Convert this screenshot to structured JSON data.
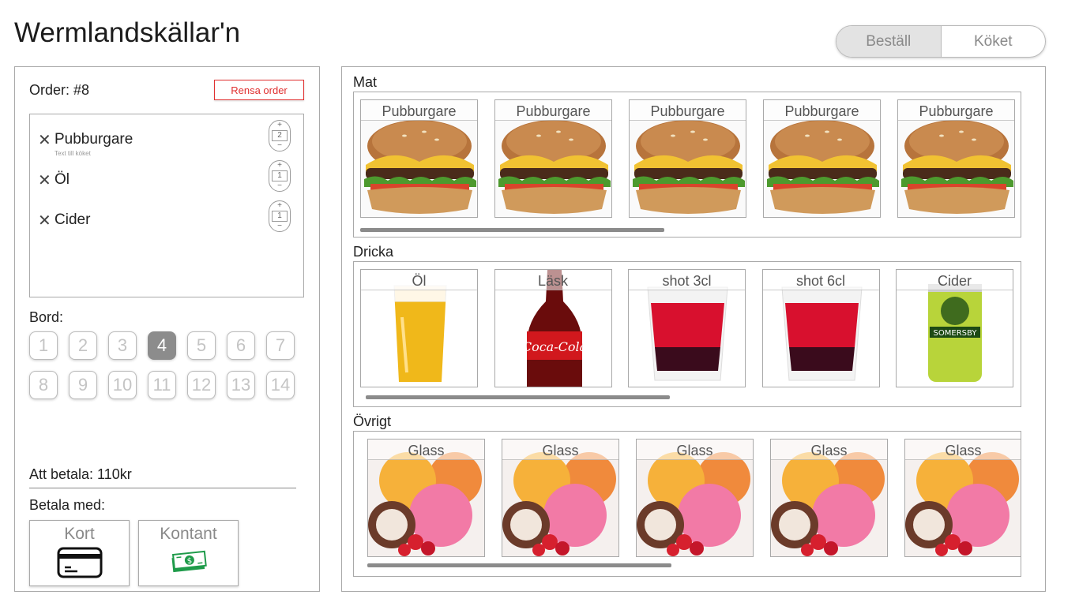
{
  "app": {
    "title": "Wermlandskällar'n"
  },
  "mode_toggle": {
    "order": "Beställ",
    "kitchen": "Köket"
  },
  "order": {
    "label": "Order: #8",
    "clear_label": "Rensa order",
    "items": [
      {
        "name": "Pubburgare",
        "note": "Text till köket",
        "qty": "2"
      },
      {
        "name": "Öl",
        "note": "",
        "qty": "1"
      },
      {
        "name": "Cider",
        "note": "",
        "qty": "1"
      }
    ],
    "plus": "+",
    "minus": "−",
    "remove": "✕"
  },
  "tables": {
    "label": "Bord:",
    "numbers": [
      "1",
      "2",
      "3",
      "4",
      "5",
      "6",
      "7",
      "8",
      "9",
      "10",
      "11",
      "12",
      "13",
      "14"
    ],
    "selected": "4"
  },
  "payment": {
    "amount_label": "Att betala: 110kr",
    "pay_with_label": "Betala med:",
    "card_label": "Kort",
    "cash_label": "Kontant",
    "card_icon": "credit-card-icon",
    "cash_icon": "cash-icon"
  },
  "menu": {
    "food": {
      "label": "Mat",
      "items": [
        "Pubburgare",
        "Pubburgare",
        "Pubburgare",
        "Pubburgare",
        "Pubburgare"
      ]
    },
    "drinks": {
      "label": "Dricka",
      "items": [
        "Öl",
        "Läsk",
        "shot 3cl",
        "shot 6cl",
        "Cider"
      ]
    },
    "other": {
      "label": "Övrigt",
      "items": [
        "Glass",
        "Glass",
        "Glass",
        "Glass",
        "Glass"
      ]
    }
  },
  "colors": {
    "accent_red": "#e03030",
    "selected_table": "#8c8c8c",
    "cash_green": "#1f9b4a"
  }
}
